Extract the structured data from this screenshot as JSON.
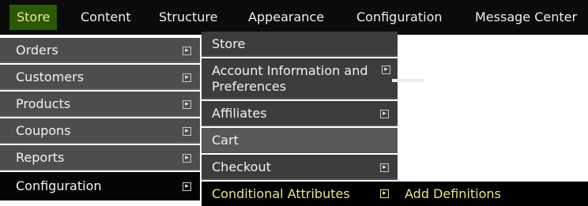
{
  "top_menu": {
    "items": [
      {
        "label": "Store"
      },
      {
        "label": "Content"
      },
      {
        "label": "Structure"
      },
      {
        "label": "Appearance"
      },
      {
        "label": "Configuration"
      },
      {
        "label": "Message Center"
      }
    ]
  },
  "store_menu": {
    "items": [
      {
        "label": "Orders",
        "icon": "submenu-arrow-icon"
      },
      {
        "label": "Customers",
        "icon": "submenu-arrow-icon"
      },
      {
        "label": "Products",
        "icon": "submenu-arrow-icon"
      },
      {
        "label": "Coupons",
        "icon": "submenu-arrow-icon"
      },
      {
        "label": "Reports",
        "icon": "submenu-arrow-icon"
      },
      {
        "label": "Configuration",
        "icon": "submenu-arrow-icon"
      }
    ]
  },
  "configuration_menu": {
    "items": [
      {
        "label": "Store"
      },
      {
        "label": "Account Information and Preferences",
        "icon": "submenu-arrow-icon"
      },
      {
        "label": "Affiliates",
        "icon": "submenu-arrow-icon"
      },
      {
        "label": "Cart"
      },
      {
        "label": "Checkout",
        "icon": "submenu-arrow-icon"
      },
      {
        "label": "Conditional Attributes",
        "icon": "submenu-arrow-icon"
      }
    ]
  },
  "conditional_attributes_menu": {
    "items": [
      {
        "label": "Add Definitions"
      }
    ]
  },
  "colors": {
    "top_bar": "#0b0b0b",
    "active_top_item": "#2a5a00",
    "active_text": "#eae38a",
    "menu_bg": "#4d4d4d",
    "submenu_bg": "#3c3c3c"
  }
}
